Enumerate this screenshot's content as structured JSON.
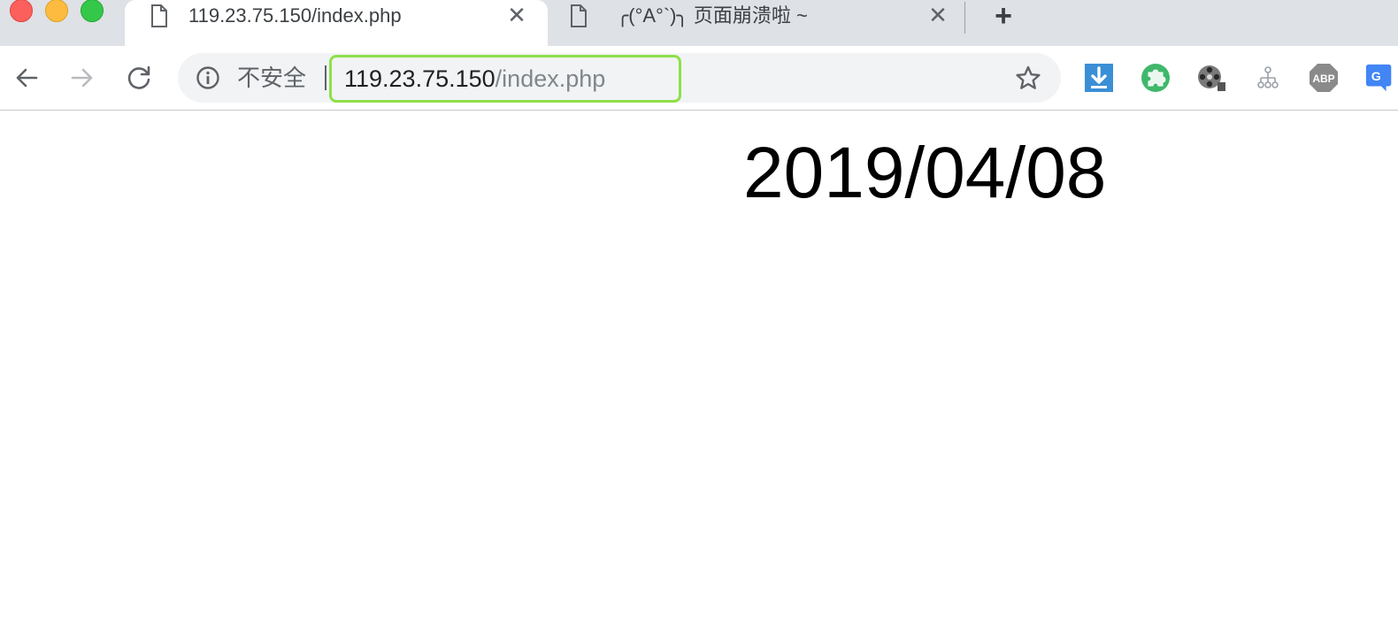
{
  "window": {
    "traffic_lights": [
      "close",
      "minimize",
      "maximize"
    ]
  },
  "tabs": [
    {
      "title": "119.23.75.150/index.php",
      "close_label": "✕",
      "active": true,
      "icon": "document-icon"
    },
    {
      "title": "╭(°A°`)╮  页面崩溃啦 ~",
      "close_label": "✕",
      "active": false,
      "icon": "document-icon"
    }
  ],
  "new_tab_label": "+",
  "toolbar": {
    "back_icon": "arrow-left-icon",
    "forward_icon": "arrow-right-icon",
    "reload_icon": "reload-icon",
    "security_label": "不安全",
    "url_host": "119.23.75.150",
    "url_path": "/index.php",
    "bookmark_icon": "star-icon",
    "highlight_color": "#8ee04a"
  },
  "extensions": [
    {
      "name": "download-icon",
      "label": ""
    },
    {
      "name": "puzzle-icon",
      "label": ""
    },
    {
      "name": "film-reel-icon",
      "label": ""
    },
    {
      "name": "sitemap-icon",
      "label": ""
    },
    {
      "name": "adblock-plus-icon",
      "label": "ABP"
    },
    {
      "name": "translate-icon",
      "label": "G"
    }
  ],
  "page": {
    "heading": "2019/04/08"
  }
}
